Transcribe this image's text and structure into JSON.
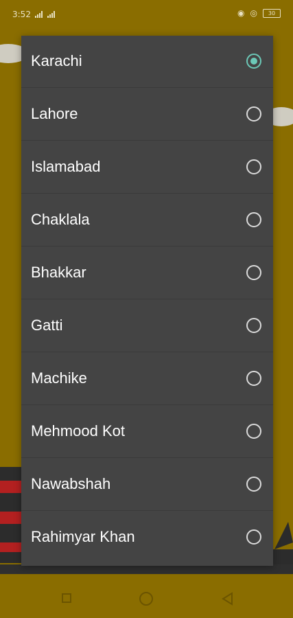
{
  "status_bar": {
    "time": "3:52",
    "battery": "30"
  },
  "dialog": {
    "selected_index": 0,
    "options": [
      {
        "label": "Karachi",
        "checked": true
      },
      {
        "label": "Lahore",
        "checked": false
      },
      {
        "label": "Islamabad",
        "checked": false
      },
      {
        "label": "Chaklala",
        "checked": false
      },
      {
        "label": "Bhakkar",
        "checked": false
      },
      {
        "label": "Gatti",
        "checked": false
      },
      {
        "label": "Machike",
        "checked": false
      },
      {
        "label": "Mehmood Kot",
        "checked": false
      },
      {
        "label": "Nawabshah",
        "checked": false
      },
      {
        "label": "Rahimyar Khan",
        "checked": false
      }
    ]
  },
  "colors": {
    "background": "#8a6d00",
    "dialog": "#444444",
    "accent": "#6cc9b8"
  },
  "icons": {
    "nav_recent": "square-icon",
    "nav_home": "circle-icon",
    "nav_back": "triangle-back-icon"
  }
}
